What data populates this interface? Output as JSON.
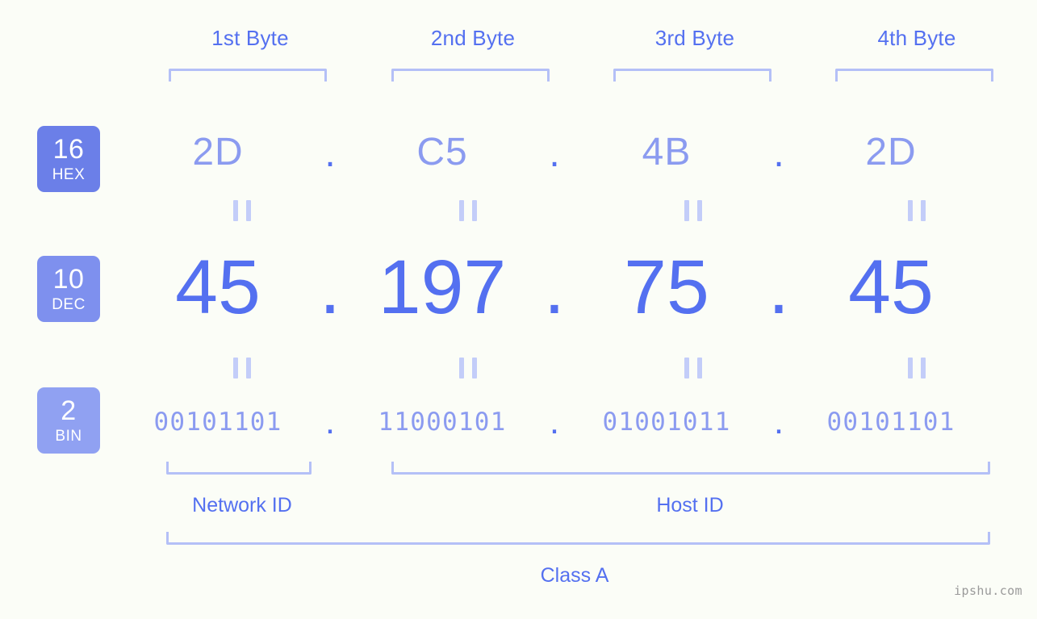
{
  "meta": {
    "background": "#fbfdf7",
    "accent": "#5470f0",
    "accent_light": "#8b9bf0",
    "bracket_color": "#b4c0f7",
    "eq_color": "#c3cdf9"
  },
  "byte_headers": [
    {
      "label": "1st Byte"
    },
    {
      "label": "2nd Byte"
    },
    {
      "label": "3rd Byte"
    },
    {
      "label": "4th Byte"
    }
  ],
  "bases": [
    {
      "num": "16",
      "tag": "HEX",
      "color": "#6b7fe8"
    },
    {
      "num": "10",
      "tag": "DEC",
      "color": "#7e90ee"
    },
    {
      "num": "2",
      "tag": "BIN",
      "color": "#90a1f2"
    }
  ],
  "rows": {
    "hex": {
      "values": [
        "2D",
        "C5",
        "4B",
        "2D"
      ],
      "separator": "."
    },
    "dec": {
      "values": [
        "45",
        "197",
        "75",
        "45"
      ],
      "separator": "."
    },
    "bin": {
      "values": [
        "00101101",
        "11000101",
        "01001011",
        "00101101"
      ],
      "separator": "."
    }
  },
  "equals_mark": "=",
  "sections": [
    {
      "label": "Network ID"
    },
    {
      "label": "Host ID"
    }
  ],
  "class_label": "Class A",
  "watermark": "ipshu.com",
  "ip_address": {
    "decimal": "45.197.75.45",
    "hex": "2D.C5.4B.2D",
    "binary": "00101101.11000101.01001011.00101101",
    "class": "Class A",
    "network_id_bytes": 1,
    "host_id_bytes": 3
  }
}
